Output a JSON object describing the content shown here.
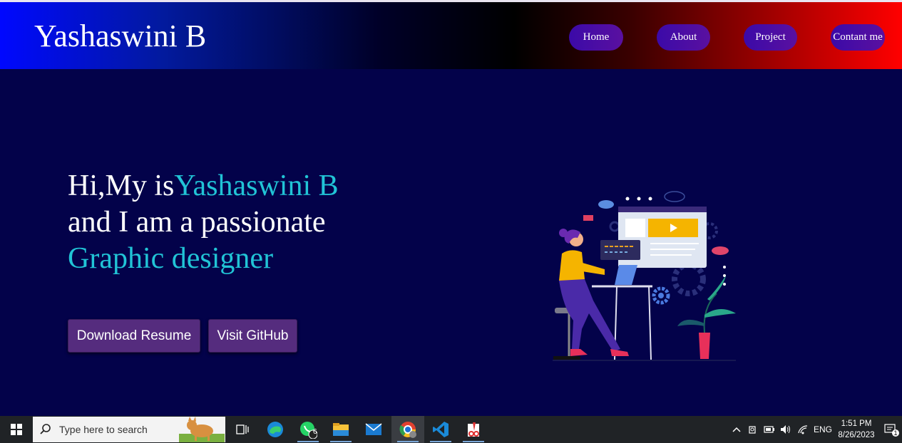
{
  "header": {
    "brand": "Yashaswini B",
    "nav": [
      "Home",
      "About",
      "Project",
      "Contant me"
    ]
  },
  "hero": {
    "line1_prefix": "Hi,My is",
    "line1_name": "Yashaswini B",
    "line2": "and I am a passionate",
    "line3": "Graphic designer",
    "buttons": {
      "resume": "Download Resume",
      "github": "Visit GitHub"
    }
  },
  "colors": {
    "accent": "#21c4d6",
    "background": "#03024a",
    "button": "#552c7e"
  },
  "taskbar": {
    "search_placeholder": "Type here to search",
    "whatsapp_badge": "6",
    "language": "ENG",
    "time": "1:51 PM",
    "date": "8/26/2023",
    "notification_count": "1",
    "icons": [
      "windows-start-icon",
      "search-icon",
      "task-view-icon",
      "edge-icon",
      "whatsapp-icon",
      "file-explorer-icon",
      "mail-icon",
      "chrome-icon",
      "vscode-icon",
      "paint-icon"
    ]
  }
}
